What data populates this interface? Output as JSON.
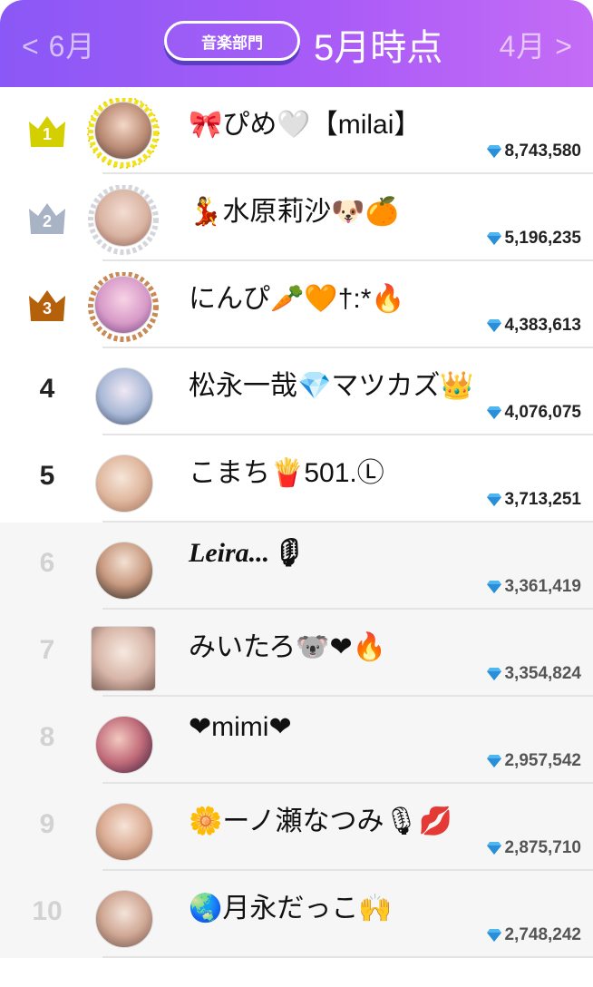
{
  "header": {
    "prev_month": "< 6月",
    "next_month": "4月 >",
    "department": "音楽部門",
    "current_month": "5月時点"
  },
  "colors": {
    "header_gradient": [
      "#8a58f6",
      "#c46cf6"
    ],
    "gold": "#d4cf00",
    "silver": "#a9b3c6",
    "bronze": "#b5600b",
    "diamond": "#4fb6f2"
  },
  "rankings": [
    {
      "rank": "1",
      "name": "🎀ぴめ🤍【milai】",
      "score": "8,743,580",
      "badge": "gold-crown"
    },
    {
      "rank": "2",
      "name": "💃水原莉沙🐶🍊",
      "score": "5,196,235",
      "badge": "silver-crown"
    },
    {
      "rank": "3",
      "name": "にんぴ🥕🧡†:*🔥",
      "score": "4,383,613",
      "badge": "bronze-crown"
    },
    {
      "rank": "4",
      "name": "松永一哉💎マツカズ👑",
      "score": "4,076,075"
    },
    {
      "rank": "5",
      "name": "こまち🍟501.Ⓛ",
      "score": "3,713,251"
    },
    {
      "rank": "6",
      "name": "Leira...🎙",
      "score": "3,361,419"
    },
    {
      "rank": "7",
      "name": "みいたろ🐨❤🔥",
      "score": "3,354,824"
    },
    {
      "rank": "8",
      "name": "❤mimi❤",
      "score": "2,957,542"
    },
    {
      "rank": "9",
      "name": "🌼ーノ瀬なつみ🎙💋",
      "score": "2,875,710"
    },
    {
      "rank": "10",
      "name": "🌏月永だっこ🙌",
      "score": "2,748,242"
    }
  ]
}
